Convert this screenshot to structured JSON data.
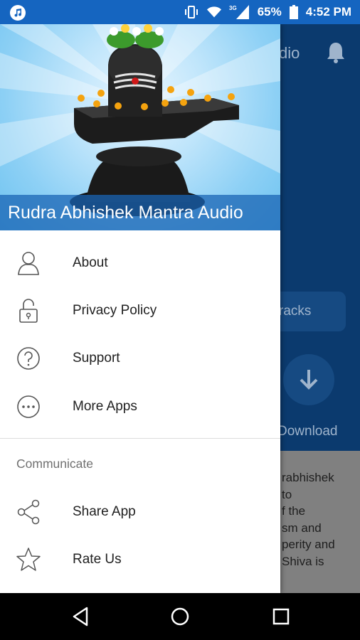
{
  "status_bar": {
    "battery_percent": "65%",
    "time": "4:52 PM",
    "network_type": "3G",
    "icons": [
      "music-app-icon",
      "vibrate-icon",
      "wifi-icon",
      "signal-icon",
      "battery-icon"
    ]
  },
  "background_app": {
    "toolbar_title_fragment": "dio",
    "tracks_button_fragment": "racks",
    "download_label_fragment": "Download",
    "description_fragment": "rabhishek\nto\nf the\nsm and\nperity and\nShiva is"
  },
  "drawer": {
    "header_title": "Rudra Abhishek Mantra Audio",
    "menu_items": [
      {
        "label": "About",
        "icon": "person-icon"
      },
      {
        "label": "Privacy Policy",
        "icon": "lock-icon"
      },
      {
        "label": "Support",
        "icon": "help-icon"
      },
      {
        "label": "More Apps",
        "icon": "more-icon"
      }
    ],
    "section_title": "Communicate",
    "communicate_items": [
      {
        "label": "Share App",
        "icon": "share-icon"
      },
      {
        "label": "Rate Us",
        "icon": "star-icon"
      }
    ]
  },
  "nav_bar": {
    "buttons": [
      "back-icon",
      "home-icon",
      "recents-icon"
    ]
  },
  "colors": {
    "status_bar": "#1565c0",
    "background_app": "#0b3a6e",
    "drawer_title_band": "#1964b4",
    "menu_text": "#212121",
    "section_text": "#707070"
  }
}
